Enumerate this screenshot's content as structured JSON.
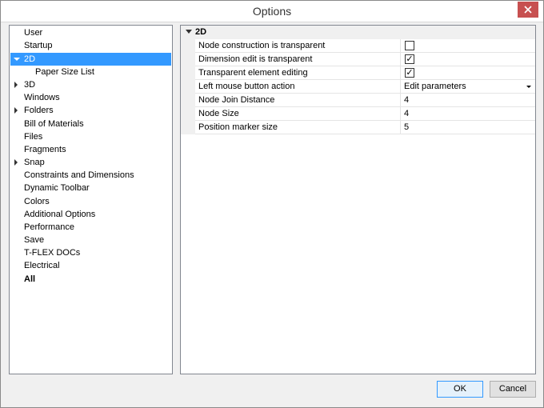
{
  "window": {
    "title": "Options"
  },
  "tree": {
    "items": [
      {
        "label": "User"
      },
      {
        "label": "Startup"
      },
      {
        "label": "2D"
      },
      {
        "label": "Paper Size List"
      },
      {
        "label": "3D"
      },
      {
        "label": "Windows"
      },
      {
        "label": "Folders"
      },
      {
        "label": "Bill of Materials"
      },
      {
        "label": "Files"
      },
      {
        "label": "Fragments"
      },
      {
        "label": "Snap"
      },
      {
        "label": "Constraints and Dimensions"
      },
      {
        "label": "Dynamic Toolbar"
      },
      {
        "label": "Colors"
      },
      {
        "label": "Additional Options"
      },
      {
        "label": "Performance"
      },
      {
        "label": "Save"
      },
      {
        "label": "T-FLEX DOCs"
      },
      {
        "label": "Electrical"
      },
      {
        "label": "All"
      }
    ],
    "selected": "2D"
  },
  "grid": {
    "section": "2D",
    "rows": [
      {
        "name": "Node construction is transparent",
        "value": "",
        "checked": false
      },
      {
        "name": "Dimension edit is transparent",
        "value": "✓",
        "checked": true
      },
      {
        "name": "Transparent element editing",
        "value": "✓",
        "checked": true
      },
      {
        "name": "Left mouse button action",
        "value": "Edit parameters"
      },
      {
        "name": "Node Join Distance",
        "value": "4"
      },
      {
        "name": "Node Size",
        "value": "4"
      },
      {
        "name": "Position marker size",
        "value": "5"
      }
    ]
  },
  "buttons": {
    "ok": "OK",
    "cancel": "Cancel"
  },
  "colors": {
    "selection": "#3399ff",
    "close": "#c75050"
  }
}
